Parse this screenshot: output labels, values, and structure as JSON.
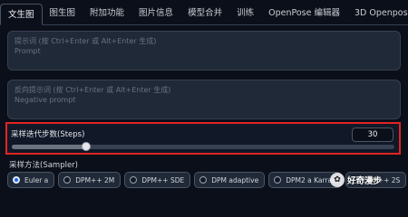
{
  "tabs": [
    {
      "label": "文生图",
      "active": true
    },
    {
      "label": "图生图",
      "active": false
    },
    {
      "label": "附加功能",
      "active": false
    },
    {
      "label": "图片信息",
      "active": false
    },
    {
      "label": "模型合并",
      "active": false
    },
    {
      "label": "训练",
      "active": false
    },
    {
      "label": "OpenPose 编辑器",
      "active": false
    },
    {
      "label": "3D Openpose",
      "active": false
    }
  ],
  "prompt": {
    "hint": "提示词 (按 Ctrl+Enter 或 Alt+Enter 生成)",
    "placeholder": "Prompt"
  },
  "negative_prompt": {
    "hint": "反向提示词 (按 Ctrl+Enter 或 Alt+Enter 生成)",
    "placeholder": "Negative prompt"
  },
  "steps": {
    "label": "采样迭代步数(Steps)",
    "value": "30",
    "min": 1,
    "max": 150,
    "current": 30
  },
  "sampler": {
    "label": "采样方法(Sampler)",
    "options": [
      {
        "label": "Euler a",
        "checked": true
      },
      {
        "label": "DPM++ 2M",
        "checked": false
      },
      {
        "label": "DPM++ SDE",
        "checked": false
      },
      {
        "label": "DPM adaptive",
        "checked": false
      },
      {
        "label": "DPM2 a Karras",
        "checked": false
      },
      {
        "label": "DPM++ 2S",
        "checked": false
      }
    ]
  },
  "watermark": {
    "text": "好奇漫步"
  },
  "colors": {
    "background": "#0b0f19",
    "highlight": "#e02424",
    "radio_checked": "#2563eb"
  }
}
